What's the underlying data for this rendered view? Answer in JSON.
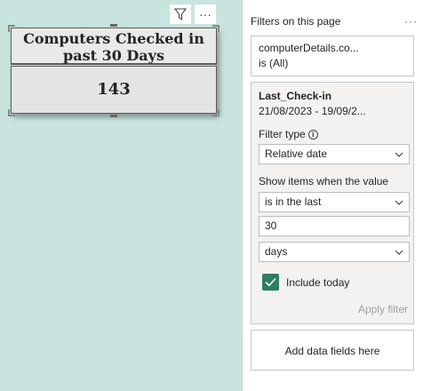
{
  "card": {
    "title": "Computers Checked in past 30 Days",
    "value": "143"
  },
  "visual_header": {
    "filter_icon": "filter-icon",
    "more_icon": "more-options-icon",
    "more_glyph": "···"
  },
  "filters_pane": {
    "title": "Filters on this page",
    "more_glyph": "···",
    "field1": {
      "name": "computerDetails.co...",
      "state": "is (All)"
    },
    "field2": {
      "name": "Last_Check-in",
      "range": "21/08/2023 - 19/09/2...",
      "filter_type_label": "Filter type",
      "filter_type_value": "Relative date",
      "show_items_label": "Show items when the value",
      "condition_value": "is in the last",
      "amount_value": "30",
      "unit_value": "days",
      "include_today_label": "Include today",
      "include_today_checked": true,
      "apply_label": "Apply filter"
    },
    "add_fields_label": "Add data fields here"
  },
  "colors": {
    "canvas_bg": "#c9e4df",
    "checkbox_accent": "#2e7d60"
  }
}
